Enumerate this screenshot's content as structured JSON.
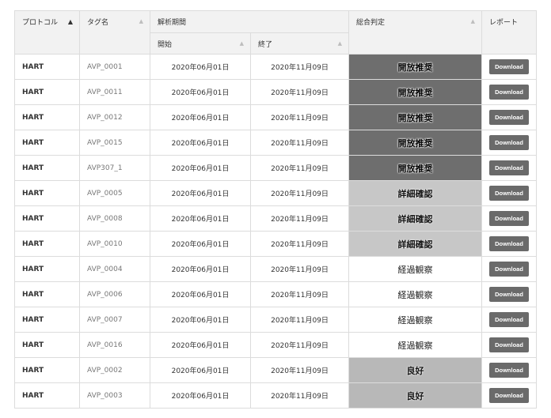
{
  "header": {
    "protocol": "プロトコル",
    "tag": "タグ名",
    "period": "解析期間",
    "start": "開始",
    "end": "終了",
    "verdict": "総合判定",
    "report": "レポート"
  },
  "icons": {
    "sort_active": "▲",
    "sort_inactive": "▲"
  },
  "rows": [
    {
      "protocol": "HART",
      "tag": "AVP_0001",
      "start": "2020年06月01日",
      "end": "2020年11月09日",
      "verdict": "開放推奨",
      "level": "dark",
      "report": "Download"
    },
    {
      "protocol": "HART",
      "tag": "AVP_0011",
      "start": "2020年06月01日",
      "end": "2020年11月09日",
      "verdict": "開放推奨",
      "level": "dark",
      "report": "Download"
    },
    {
      "protocol": "HART",
      "tag": "AVP_0012",
      "start": "2020年06月01日",
      "end": "2020年11月09日",
      "verdict": "開放推奨",
      "level": "dark",
      "report": "Download"
    },
    {
      "protocol": "HART",
      "tag": "AVP_0015",
      "start": "2020年06月01日",
      "end": "2020年11月09日",
      "verdict": "開放推奨",
      "level": "dark",
      "report": "Download"
    },
    {
      "protocol": "HART",
      "tag": "AVP307_1",
      "start": "2020年06月01日",
      "end": "2020年11月09日",
      "verdict": "開放推奨",
      "level": "dark",
      "report": "Download"
    },
    {
      "protocol": "HART",
      "tag": "AVP_0005",
      "start": "2020年06月01日",
      "end": "2020年11月09日",
      "verdict": "詳細確認",
      "level": "light",
      "report": "Download"
    },
    {
      "protocol": "HART",
      "tag": "AVP_0008",
      "start": "2020年06月01日",
      "end": "2020年11月09日",
      "verdict": "詳細確認",
      "level": "light",
      "report": "Download"
    },
    {
      "protocol": "HART",
      "tag": "AVP_0010",
      "start": "2020年06月01日",
      "end": "2020年11月09日",
      "verdict": "詳細確認",
      "level": "light",
      "report": "Download"
    },
    {
      "protocol": "HART",
      "tag": "AVP_0004",
      "start": "2020年06月01日",
      "end": "2020年11月09日",
      "verdict": "経過観察",
      "level": "none",
      "report": "Download"
    },
    {
      "protocol": "HART",
      "tag": "AVP_0006",
      "start": "2020年06月01日",
      "end": "2020年11月09日",
      "verdict": "経過観察",
      "level": "none",
      "report": "Download"
    },
    {
      "protocol": "HART",
      "tag": "AVP_0007",
      "start": "2020年06月01日",
      "end": "2020年11月09日",
      "verdict": "経過観察",
      "level": "none",
      "report": "Download"
    },
    {
      "protocol": "HART",
      "tag": "AVP_0016",
      "start": "2020年06月01日",
      "end": "2020年11月09日",
      "verdict": "経過観察",
      "level": "none",
      "report": "Download"
    },
    {
      "protocol": "HART",
      "tag": "AVP_0002",
      "start": "2020年06月01日",
      "end": "2020年11月09日",
      "verdict": "良好",
      "level": "mid",
      "report": "Download"
    },
    {
      "protocol": "HART",
      "tag": "AVP_0003",
      "start": "2020年06月01日",
      "end": "2020年11月09日",
      "verdict": "良好",
      "level": "mid",
      "report": "Download"
    }
  ],
  "colors": {
    "dark": "#6e6e6e",
    "light": "#c7c7c7",
    "mid": "#b8b8b8",
    "none": "#ffffff",
    "button": "#6a6a6a",
    "header_bg": "#f2f2f2"
  }
}
